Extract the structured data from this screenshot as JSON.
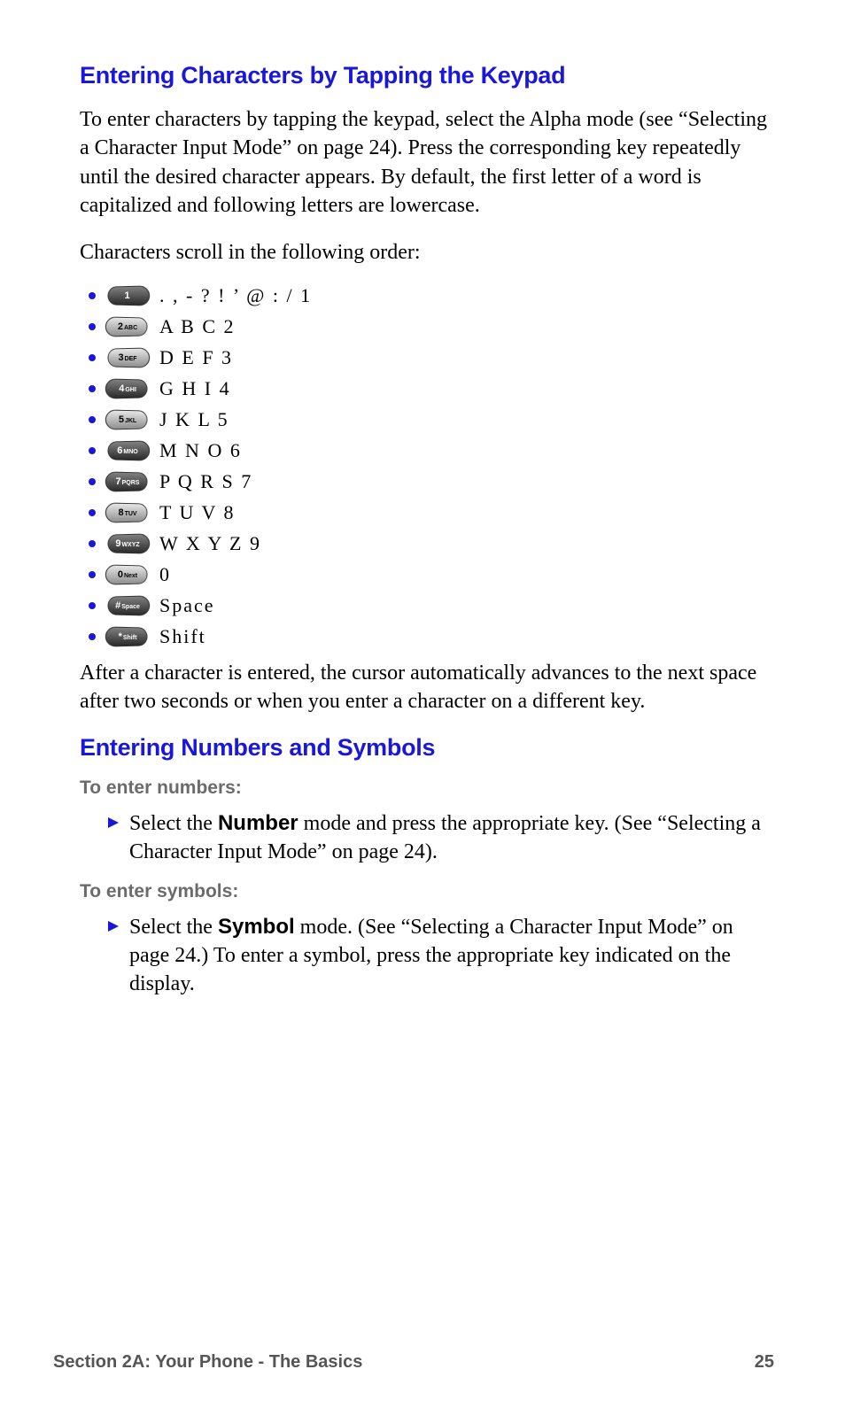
{
  "heading1": "Entering Characters by Tapping the Keypad",
  "para1": "To enter characters by tapping the keypad, select the Alpha mode (see “Selecting a Character Input Mode” on page 24). Press the corresponding key repeatedly until the desired character appears. By default, the first letter of a word is capitalized and following letters are lowercase.",
  "para2": "Characters scroll in the following order:",
  "keys": [
    {
      "keyLabel": "1",
      "dark": true,
      "side": "sl",
      "chars": ". , - ? ! ’ @ : / 1"
    },
    {
      "keyLabel": "2 ABC",
      "dark": false,
      "side": "sr",
      "chars": "A B C 2"
    },
    {
      "keyLabel": "3 DEF",
      "dark": false,
      "side": "sl",
      "chars": "D E F 3"
    },
    {
      "keyLabel": "4 GHI",
      "dark": true,
      "side": "sr",
      "chars": "G H I 4"
    },
    {
      "keyLabel": "5 JKL",
      "dark": false,
      "side": "sr",
      "chars": "J K L 5"
    },
    {
      "keyLabel": "6 MNO",
      "dark": true,
      "side": "sl",
      "chars": "M N O 6"
    },
    {
      "keyLabel": "7 PQRS",
      "dark": true,
      "side": "sr",
      "chars": "P Q R S 7"
    },
    {
      "keyLabel": "8 TUV",
      "dark": false,
      "side": "sr",
      "chars": "T U V 8"
    },
    {
      "keyLabel": "9 WXYZ",
      "dark": true,
      "side": "sl",
      "chars": "W X Y Z 9"
    },
    {
      "keyLabel": "0 Next",
      "dark": false,
      "side": "sr",
      "chars": "0"
    },
    {
      "keyLabel": "# Space",
      "dark": true,
      "side": "sl",
      "chars": "Space"
    },
    {
      "keyLabel": "* Shift",
      "dark": true,
      "side": "sr",
      "chars": "Shift"
    }
  ],
  "para3": "After a character is entered, the cursor automatically advances to the next space after two seconds or when you enter a character on a different key.",
  "heading2": "Entering Numbers and Symbols",
  "sub1": "To enter numbers:",
  "step1_pre": "Select the ",
  "step1_bold": "Number",
  "step1_post": " mode and press the appropriate key. (See “Selecting a Character Input Mode” on page 24).",
  "sub2": "To enter symbols:",
  "step2_pre": "Select the ",
  "step2_bold": "Symbol",
  "step2_post": " mode. (See “Selecting a Character Input Mode” on page 24.) To enter a symbol, press the appropriate key indicated on the display.",
  "footer_left": "Section 2A: Your Phone - The Basics",
  "footer_right": "25"
}
